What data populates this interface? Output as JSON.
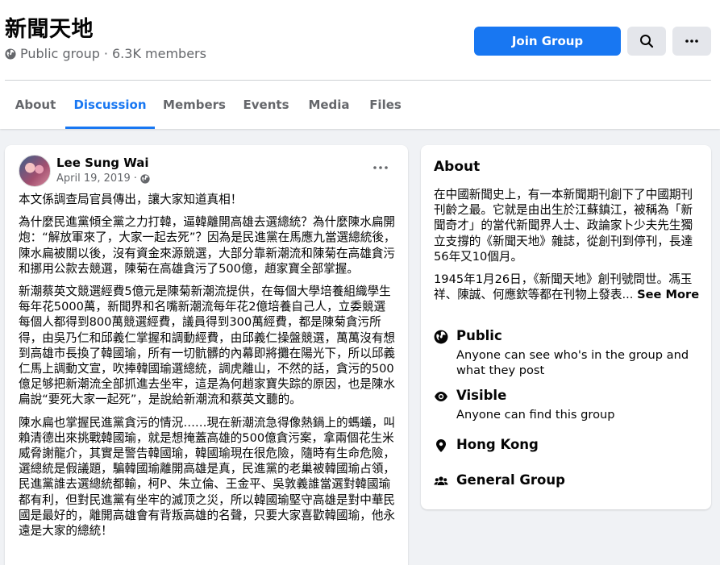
{
  "group": {
    "title": "新聞天地",
    "privacy": "Public group",
    "separator": "·",
    "members": "6.3K members",
    "join_label": "Join Group"
  },
  "tabs": [
    {
      "label": "About"
    },
    {
      "label": "Discussion"
    },
    {
      "label": "Members"
    },
    {
      "label": "Events"
    },
    {
      "label": "Media"
    },
    {
      "label": "Files"
    }
  ],
  "active_tab": "Discussion",
  "post": {
    "author": "Lee Sung Wai",
    "date": "April 19, 2019",
    "date_separator": "·",
    "paragraphs": [
      "本文係調查局官員傳出，讓大家知道真相！",
      "為什麼民進黨傾全黨之力打韓，逼韓離開高雄去選總統？為什麼陳水扁開炮：“解放軍來了，大家一起去死”？因為是民進黨在馬應九當選總統後，陳水扁被關以後，沒有資金來源競選，大部分靠新潮流和陳菊在高雄貪污和挪用公款去競選，陳菊在高雄貪污了500億，趙家寶全部掌握。",
      "新潮蔡英文競選經費5億元是陳菊新潮流提供，在每個大學培養組織學生每年花5000萬，新聞界和名嘴新潮流每年花2億培養自己人，立委競選每個人都得到800萬競選經費，議員得到300萬經費，都是陳菊貪污所得，由吳乃仁和邱義仁掌握和調動經費，由邱義仁操盤競選，萬萬沒有想到高雄市長換了韓國瑜，所有一切骯髒的內幕即將攤在陽光下，所以邱義仁馬上調動文宣，吹捧韓國瑜選總統，調虎離山，不然的話，貪污的500億足够把新潮流全部抓進去坐牢，這是為何趙家寶失踪的原因，也是陳水扁說“要死大家一起死”，是說給新潮流和蔡英文聽的。",
      "陳水扁也掌握民進黨貪污的情況……現在新潮流急得像熱鍋上的螞蟻，叫賴清德出來挑戰韓國瑜，就是想掩蓋高雄的500億貪污案，拿兩個花生米威脅謝龍介，其實是警告韓國瑜，韓國瑜現在很危險，隨時有生命危險，選總統是假議題，騙韓國瑜離開高雄是真，民進黨的老巢被韓國瑜占領，民進黨誰去選總統都輸，柯P、朱立倫、王金平、吳敦義誰當選對韓國瑜都有利，但對民進黨有坐牢的滅顶之災，所以韓國瑜堅守高雄是對中華民國是最好的，離開高雄會有背叛高雄的名聲，只要大家喜歡韓國瑜，他永遠是大家的總統！"
    ]
  },
  "about": {
    "title": "About",
    "desc1": "在中國新聞史上，有一本新聞期刊創下了中國期刊刊齡之最。它就是由出生於江蘇鎮江，被稱為「新聞奇才」的當代新聞界人士、政論家卜少夫先生獨立支撐的《新聞天地》雜誌，從創刊到停刊，長達56年又10個月。",
    "desc2": "1945年1月26日，《新聞天地》創刊號問世。馮玉祥、陳誠、何應欽等都在刊物上發表...",
    "see_more": "See More",
    "items": [
      {
        "icon": "globe-icon",
        "title": "Public",
        "sub": "Anyone can see who's in the group and what they post"
      },
      {
        "icon": "eye-icon",
        "title": "Visible",
        "sub": "Anyone can find this group"
      },
      {
        "icon": "location-pin-icon",
        "title": "Hong Kong",
        "sub": ""
      },
      {
        "icon": "people-icon",
        "title": "General Group",
        "sub": ""
      }
    ]
  },
  "colors": {
    "accent": "#1877f2",
    "secondary_text": "#65676b",
    "background": "#f0f2f5",
    "button_gray": "#e4e6eb"
  }
}
